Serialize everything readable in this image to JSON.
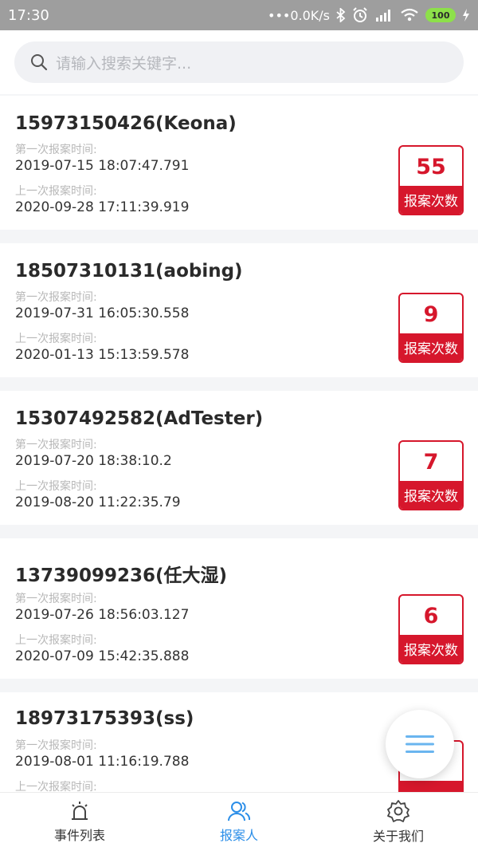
{
  "statusbar": {
    "time": "17:30",
    "net_speed": "•••0.0K/s",
    "battery": "100"
  },
  "search": {
    "placeholder": "请输入搜索关键字..."
  },
  "records": [
    {
      "name": "15973150426(Keona)",
      "first_label": "第一次报案时间:",
      "first_time": "2019-07-15 18:07:47.791",
      "last_label": "上一次报案时间:",
      "last_time": "2020-09-28 17:11:39.919",
      "count": "55",
      "count_label": "报案次数"
    },
    {
      "name": "18507310131(aobing)",
      "first_label": "第一次报案时间:",
      "first_time": "2019-07-31 16:05:30.558",
      "last_label": "上一次报案时间:",
      "last_time": "2020-01-13 15:13:59.578",
      "count": "9",
      "count_label": "报案次数"
    },
    {
      "name": "15307492582(AdTester)",
      "first_label": "第一次报案时间:",
      "first_time": "2019-07-20 18:38:10.2",
      "last_label": "上一次报案时间:",
      "last_time": "2019-08-20 11:22:35.79",
      "count": "7",
      "count_label": "报案次数"
    },
    {
      "name": "13739099236(任大湿)",
      "first_label": "第一次报案时间:",
      "first_time": "2019-07-26 18:56:03.127",
      "last_label": "上一次报案时间:",
      "last_time": "2020-07-09 15:42:35.888",
      "count": "6",
      "count_label": "报案次数"
    },
    {
      "name": "18973175393(ss)",
      "first_label": "第一次报案时间:",
      "first_time": "2019-08-01 11:16:19.788",
      "last_label": "上一次报案时间:"
    }
  ],
  "tabs": {
    "events": "事件列表",
    "reporters": "报案人",
    "about": "关于我们"
  },
  "colors": {
    "accent": "#2b8ee8",
    "badge_red": "#d6172c"
  }
}
